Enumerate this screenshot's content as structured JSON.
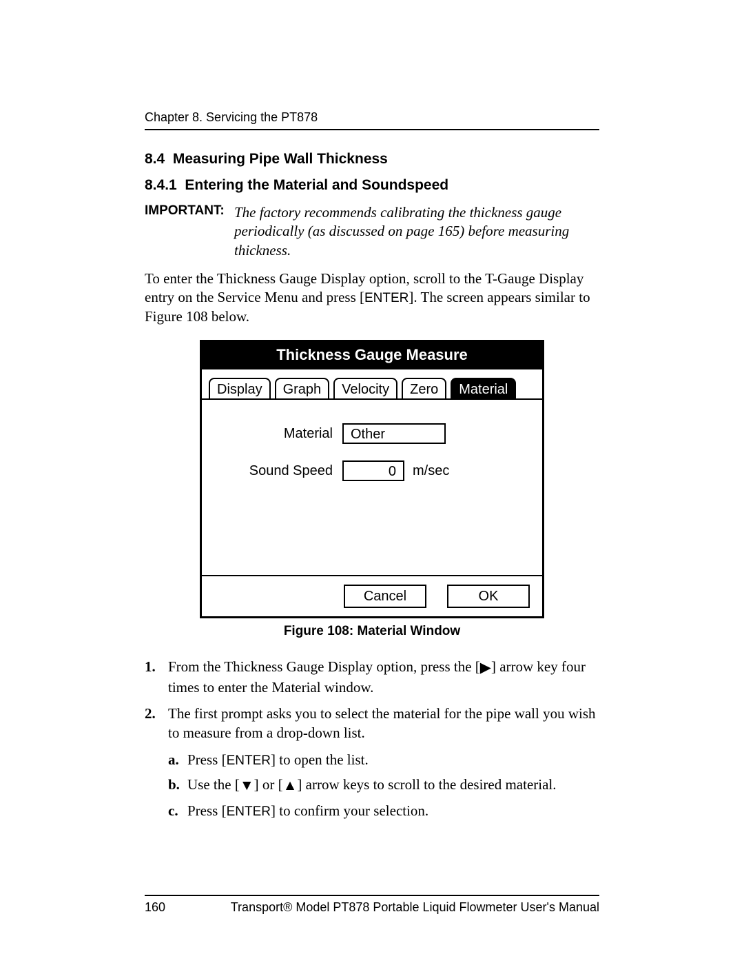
{
  "header": {
    "running_head": "Chapter 8. Servicing the PT878"
  },
  "sections": {
    "h1_num": "8.4",
    "h1_title": "Measuring Pipe Wall Thickness",
    "h2_num": "8.4.1",
    "h2_title": "Entering the Material and Soundspeed"
  },
  "important": {
    "label": "IMPORTANT:",
    "text": "The factory recommends calibrating the thickness gauge periodically (as discussed on page 165) before measuring thickness."
  },
  "intro": {
    "part1": "To enter the Thickness Gauge Display option, scroll to the T-Gauge Display entry on the Service Menu and press [",
    "enter": "ENTER",
    "part2": "]. The screen appears similar to Figure 108 below."
  },
  "device": {
    "title": "Thickness Gauge Measure",
    "tabs": [
      "Display",
      "Graph",
      "Velocity",
      "Zero",
      "Material"
    ],
    "active_tab_index": 4,
    "fields": {
      "material_label": "Material",
      "material_value": "Other",
      "soundspeed_label": "Sound Speed",
      "soundspeed_value": "0",
      "soundspeed_unit": "m/sec"
    },
    "buttons": {
      "cancel": "Cancel",
      "ok": "OK"
    }
  },
  "figure_caption": "Figure 108: Material Window",
  "steps": {
    "s1_a": "From the Thickness Gauge Display option, press the [",
    "s1_b": "] arrow key four times to enter the Material window.",
    "s2": "The first prompt asks you to select the material for the pipe wall you wish to measure from a drop-down list.",
    "s2a_a": "Press [",
    "s2a_enter": "ENTER",
    "s2a_b": "] to open the list.",
    "s2b_a": "Use the [",
    "s2b_b": "] or [",
    "s2b_c": "] arrow keys to scroll to the desired material.",
    "s2c_a": "Press [",
    "s2c_enter": "ENTER",
    "s2c_b": "] to confirm your selection."
  },
  "markers": {
    "n1": "1.",
    "n2": "2.",
    "a": "a.",
    "b": "b.",
    "c": "c."
  },
  "footer": {
    "page": "160",
    "title": "Transport® Model PT878 Portable Liquid Flowmeter User's Manual"
  }
}
